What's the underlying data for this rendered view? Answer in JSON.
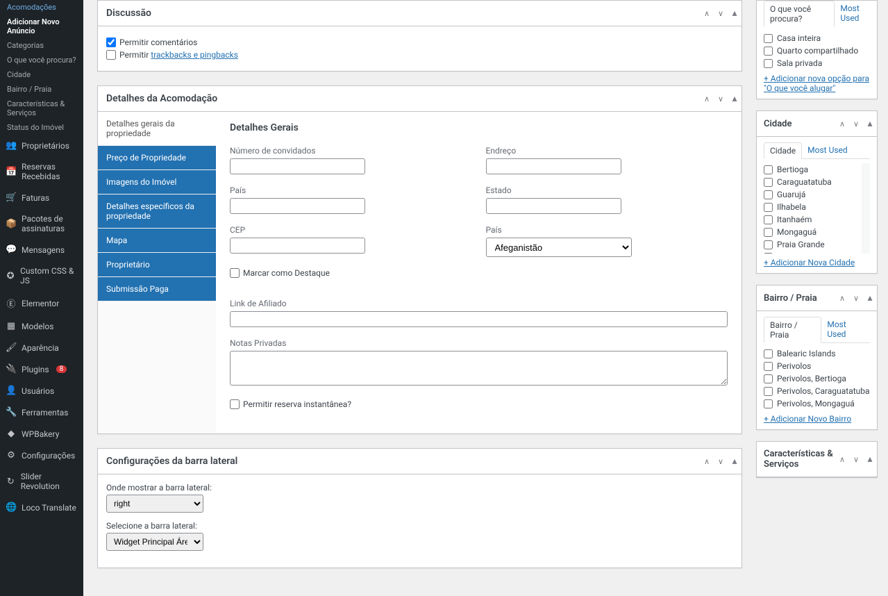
{
  "sidebar": {
    "subs": {
      "acomodacoes": "Acomodações",
      "adicionar": "Adicionar Novo Anúncio",
      "categorias": "Categorias",
      "oquevoce": "O que você procura?",
      "cidade": "Cidade",
      "bairro": "Bairro / Praia",
      "caracteristicas": "Características & Serviços",
      "status": "Status do Imóvel"
    },
    "items": {
      "proprietarios": "Proprietários",
      "reservas": "Reservas Recebidas",
      "faturas": "Faturas",
      "pacotes": "Pacotes de assinaturas",
      "mensagens": "Mensagens",
      "customcss": "Custom CSS & JS",
      "elementor": "Elementor",
      "modelos": "Modelos",
      "aparencia": "Aparência",
      "plugins": "Plugins",
      "plugins_count": "8",
      "usuarios": "Usuários",
      "ferramentas": "Ferramentas",
      "wpbakery": "WPBakery",
      "configuracoes": "Configurações",
      "slider": "Slider Revolution",
      "loco": "Loco Translate"
    }
  },
  "boxes": {
    "discussao": {
      "title": "Discussão",
      "permitir_comentarios": "Permitir comentários",
      "permitir_trackbacks_prefix": "Permitir ",
      "permitir_trackbacks_link": "trackbacks e pingbacks"
    },
    "detalhes": {
      "title": "Detalhes da Acomodação",
      "tabs": {
        "gerais": "Detalhes gerais da propriedade",
        "preco": "Preço de Propriedade",
        "imagens": "Imagens do Imóvel",
        "especificos": "Detalhes específicos da propriedade",
        "mapa": "Mapa",
        "proprietario": "Proprietário",
        "submissao": "Submissão Paga"
      },
      "section_title": "Detalhes Gerais",
      "fields": {
        "numero_convidados": "Número de convidados",
        "endereco": "Endreço",
        "pais": "País",
        "estado": "Estado",
        "cep": "CEP",
        "pais2": "País",
        "pais2_value": "Afeganistão",
        "marcar_destaque": "Marcar como Destaque",
        "link_afiliado": "Link de Afiliado",
        "notas_privadas": "Notas Privadas",
        "permitir_reserva": "Permitir reserva instantânea?"
      }
    },
    "sidebar_conf": {
      "title": "Configurações da barra lateral",
      "onde_mostrar": "Onde mostrar a barra lateral:",
      "onde_value": "right",
      "selecione": "Selecione a barra lateral:",
      "selecione_value": "Widget Principal Área De"
    }
  },
  "side": {
    "oque": {
      "title": "O que você procura?",
      "tab_most": "Most Used",
      "items": [
        "Casa inteira",
        "Quarto compartilhado",
        "Sala privada"
      ],
      "add": "+ Adicionar nova opção para \"O que você alugar\""
    },
    "cidade": {
      "title": "Cidade",
      "tab_cidade": "Cidade",
      "tab_most": "Most Used",
      "items": [
        "Bertioga",
        "Caraguatatuba",
        "Guarujá",
        "Ilhabela",
        "Itanhaém",
        "Mongaguá",
        "Praia Grande",
        "Santos"
      ],
      "add": "+ Adicionar Nova Cidade"
    },
    "bairro": {
      "title": "Bairro / Praia",
      "tab_bairro": "Bairro / Praia",
      "tab_most": "Most Used",
      "items": [
        "Balearic Islands",
        "Perivolos",
        "Perivolos, Bertioga",
        "Perivolos, Caraguatatuba",
        "Perivolos, Mongaguá"
      ],
      "add": "+ Adicionar Novo Bairro"
    },
    "caracteristicas": {
      "title": "Características & Serviços"
    }
  }
}
